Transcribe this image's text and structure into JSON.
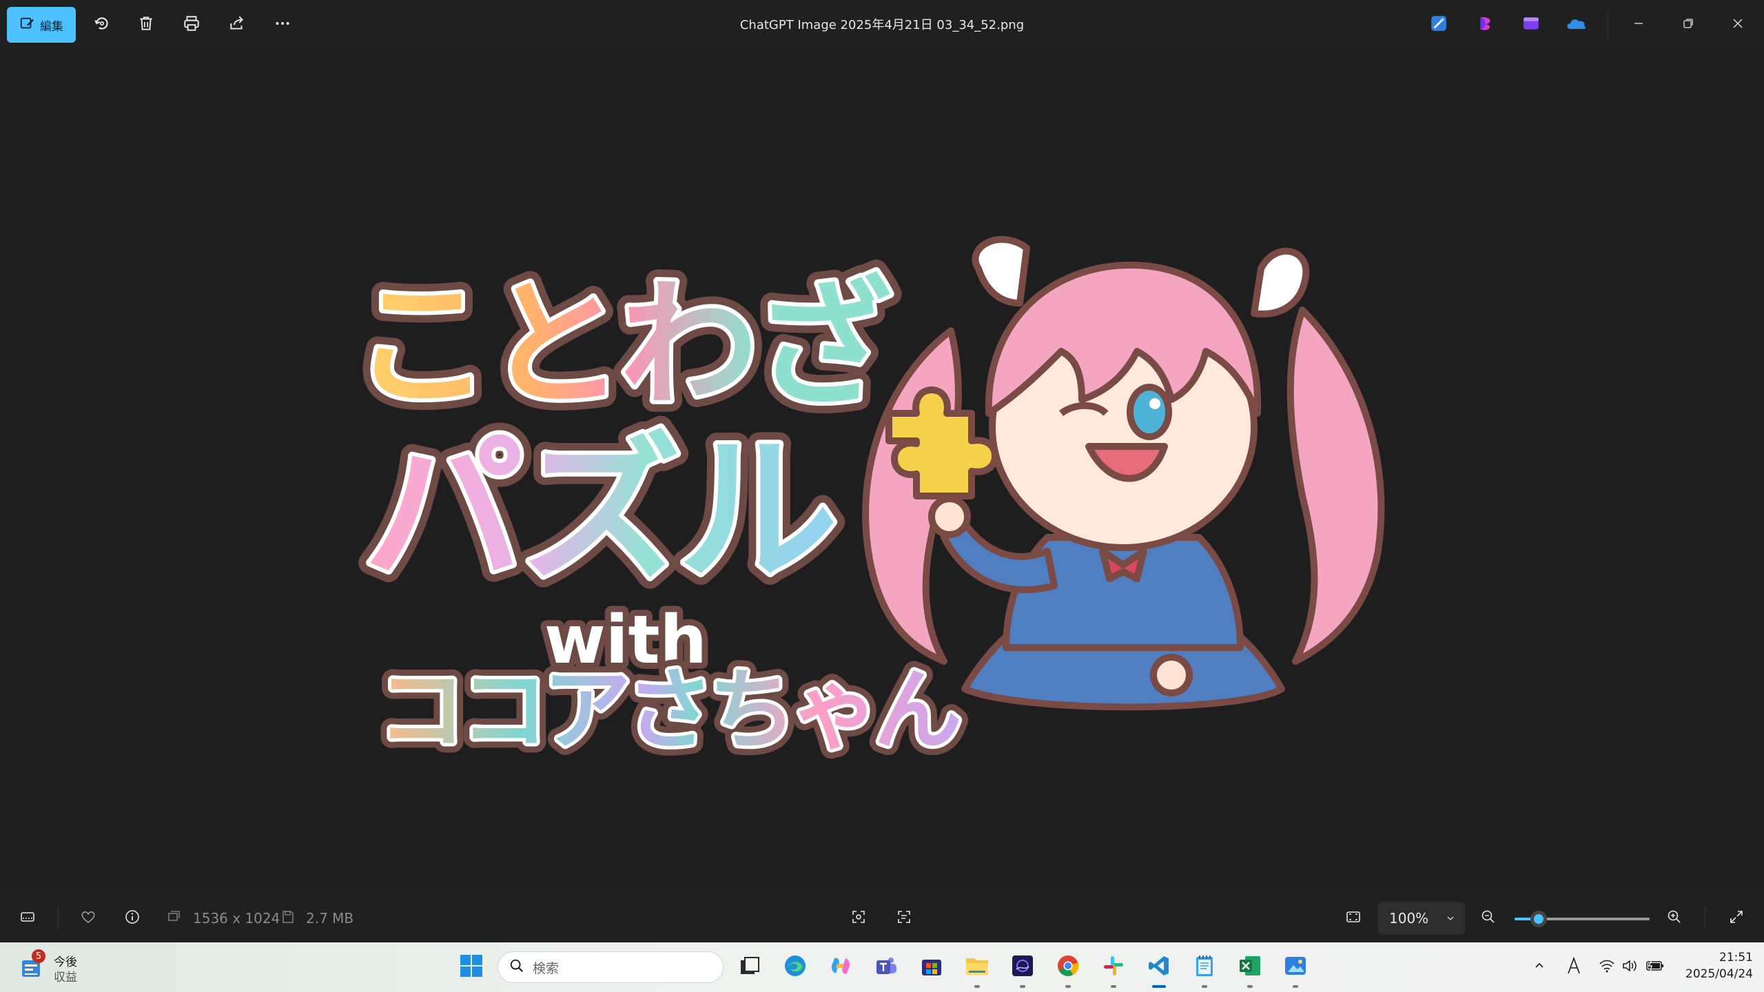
{
  "window": {
    "title": "ChatGPT Image 2025年4月21日 03_34_52.png",
    "edit_label": "編集",
    "toolbar_icons": [
      "rotate-icon",
      "delete-icon",
      "print-icon",
      "share-icon",
      "more-icon"
    ],
    "app_icons": [
      "image-creator-icon",
      "clipchamp-icon",
      "video-editor-icon",
      "onedrive-icon"
    ],
    "controls": [
      "minimize-icon",
      "restore-icon",
      "close-icon"
    ]
  },
  "artwork": {
    "line1": "ことわざ",
    "line2": "パズル",
    "line3": "with",
    "line4": "ココアさちゃん"
  },
  "bottom_bar": {
    "dimensions": "1536 x 1024",
    "file_size": "2.7 MB",
    "zoom": "100%",
    "zoom_fraction": 0.18
  },
  "taskbar": {
    "weather_badge": "5",
    "weather_line1": "今後",
    "weather_line2": "収益",
    "search_placeholder": "検索",
    "apps": [
      "start-icon",
      "task-view-icon",
      "edge-icon",
      "copilot-icon",
      "teams-icon",
      "store-icon",
      "file-explorer-icon",
      "clipchamp-icon",
      "chrome-icon",
      "slack-icon",
      "vscode-icon",
      "notepad-icon",
      "excel-icon",
      "photos-icon"
    ],
    "time": "21:51",
    "date": "2025/04/24"
  },
  "colors": {
    "accent": "#4cc2ff",
    "toolbar_bg": "#202020",
    "canvas_bg": "#1e1e1e",
    "hair_pink": "#f4a6c0",
    "dress_blue": "#4f7fc1"
  }
}
